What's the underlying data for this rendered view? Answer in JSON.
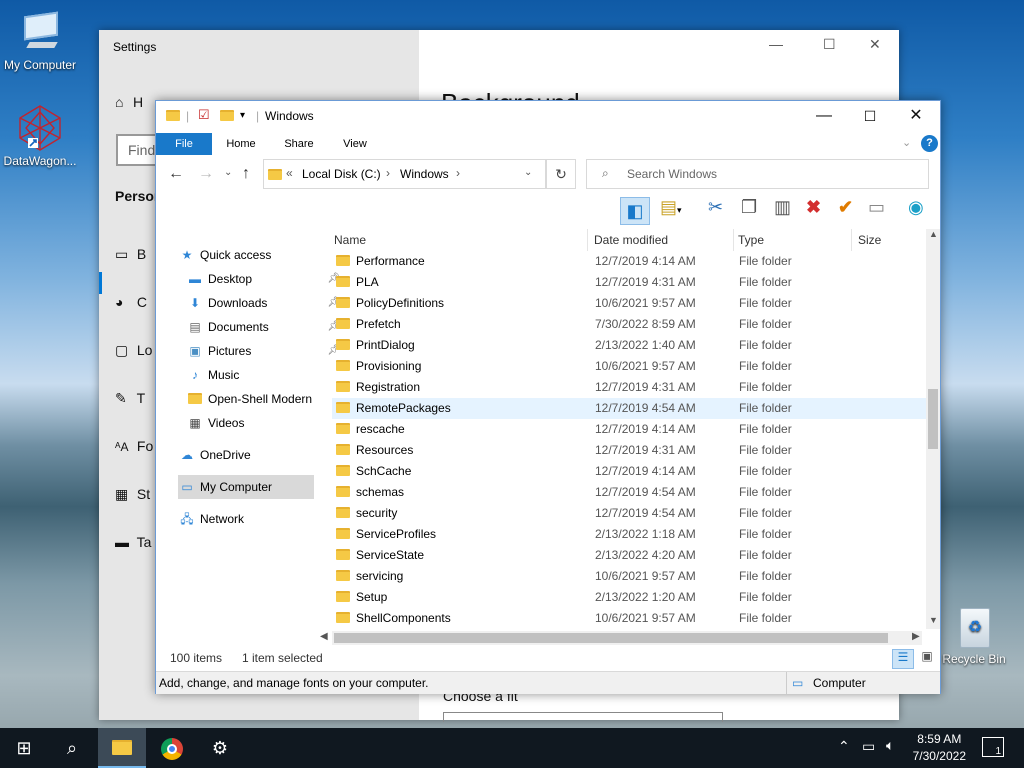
{
  "desktop": {
    "icons": [
      {
        "label": "My Computer"
      },
      {
        "label": "DataWagon..."
      },
      {
        "label": "Recycle Bin"
      }
    ]
  },
  "settings": {
    "title": "Settings",
    "home": "H",
    "find": "Find",
    "section": "Person",
    "items": [
      "B",
      "C",
      "Lo",
      "T",
      "Fo",
      "St",
      "Ta"
    ],
    "background_title": "Background",
    "choose_fit": "Choose a fit"
  },
  "explorer": {
    "title": "Windows",
    "tabs": [
      "File",
      "Home",
      "Share",
      "View"
    ],
    "address": {
      "prefix": "«",
      "parts": [
        "Local Disk (C:)",
        "Windows"
      ]
    },
    "search_placeholder": "Search Windows",
    "nav": [
      {
        "label": "Quick access",
        "icon": "star-icon"
      },
      {
        "label": "Desktop",
        "icon": "desktop-icon",
        "pinned": true
      },
      {
        "label": "Downloads",
        "icon": "download-icon",
        "pinned": true
      },
      {
        "label": "Documents",
        "icon": "document-icon",
        "pinned": true
      },
      {
        "label": "Pictures",
        "icon": "picture-icon",
        "pinned": true
      },
      {
        "label": "Music",
        "icon": "music-icon"
      },
      {
        "label": "Open-Shell Modern",
        "icon": "folder-icon"
      },
      {
        "label": "Videos",
        "icon": "video-icon"
      },
      {
        "label": "OneDrive",
        "icon": "cloud-icon"
      },
      {
        "label": "My Computer",
        "icon": "computer-icon",
        "selected": true
      },
      {
        "label": "Network",
        "icon": "network-icon"
      }
    ],
    "columns": [
      "Name",
      "Date modified",
      "Type",
      "Size"
    ],
    "rows": [
      {
        "name": "Performance",
        "date": "12/7/2019 4:14 AM",
        "type": "File folder"
      },
      {
        "name": "PLA",
        "date": "12/7/2019 4:31 AM",
        "type": "File folder"
      },
      {
        "name": "PolicyDefinitions",
        "date": "10/6/2021 9:57 AM",
        "type": "File folder"
      },
      {
        "name": "Prefetch",
        "date": "7/30/2022 8:59 AM",
        "type": "File folder"
      },
      {
        "name": "PrintDialog",
        "date": "2/13/2022 1:40 AM",
        "type": "File folder"
      },
      {
        "name": "Provisioning",
        "date": "10/6/2021 9:57 AM",
        "type": "File folder"
      },
      {
        "name": "Registration",
        "date": "12/7/2019 4:31 AM",
        "type": "File folder"
      },
      {
        "name": "RemotePackages",
        "date": "12/7/2019 4:54 AM",
        "type": "File folder",
        "highlight": true
      },
      {
        "name": "rescache",
        "date": "12/7/2019 4:14 AM",
        "type": "File folder"
      },
      {
        "name": "Resources",
        "date": "12/7/2019 4:31 AM",
        "type": "File folder"
      },
      {
        "name": "SchCache",
        "date": "12/7/2019 4:14 AM",
        "type": "File folder"
      },
      {
        "name": "schemas",
        "date": "12/7/2019 4:54 AM",
        "type": "File folder"
      },
      {
        "name": "security",
        "date": "12/7/2019 4:54 AM",
        "type": "File folder"
      },
      {
        "name": "ServiceProfiles",
        "date": "2/13/2022 1:18 AM",
        "type": "File folder"
      },
      {
        "name": "ServiceState",
        "date": "2/13/2022 4:20 AM",
        "type": "File folder"
      },
      {
        "name": "servicing",
        "date": "10/6/2021 9:57 AM",
        "type": "File folder"
      },
      {
        "name": "Setup",
        "date": "2/13/2022 1:20 AM",
        "type": "File folder"
      },
      {
        "name": "ShellComponents",
        "date": "10/6/2021 9:57 AM",
        "type": "File folder"
      }
    ],
    "status": {
      "count": "100 items",
      "selected": "1 item selected"
    },
    "statusbar": {
      "hint": "Add, change, and manage fonts on your computer.",
      "location": "Computer"
    }
  },
  "taskbar": {
    "time": "8:59 AM",
    "date": "7/30/2022",
    "notifications": "1"
  }
}
